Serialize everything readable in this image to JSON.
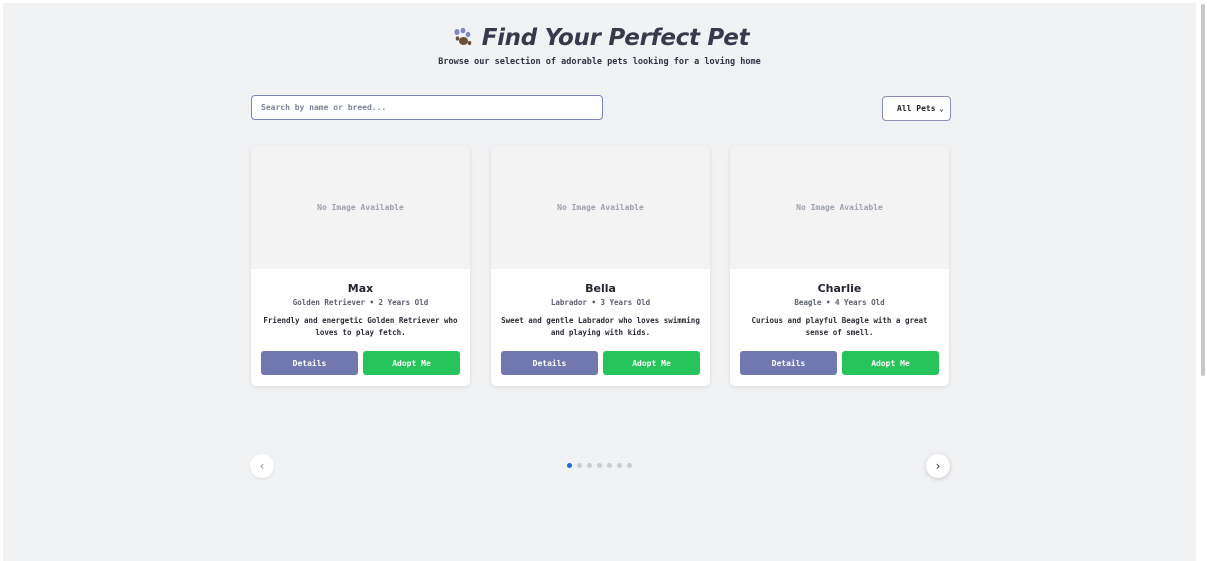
{
  "header": {
    "title": "Find Your Perfect Pet",
    "subtitle": "Browse our selection of adorable pets looking for a loving home",
    "icon": "paw-icon"
  },
  "search": {
    "placeholder": "Search by name or breed...",
    "value": ""
  },
  "filter": {
    "selected": "All Pets"
  },
  "cards": [
    {
      "image_text": "No Image Available",
      "name": "Max",
      "meta": "Golden Retriever • 2 Years Old",
      "description": "Friendly and energetic Golden Retriever who loves to play fetch.",
      "details_label": "Details",
      "adopt_label": "Adopt Me"
    },
    {
      "image_text": "No Image Available",
      "name": "Bella",
      "meta": "Labrador • 3 Years Old",
      "description": "Sweet and gentle Labrador who loves swimming and playing with kids.",
      "details_label": "Details",
      "adopt_label": "Adopt Me"
    },
    {
      "image_text": "No Image Available",
      "name": "Charlie",
      "meta": "Beagle • 4 Years Old",
      "description": "Curious and playful Beagle with a great sense of smell.",
      "details_label": "Details",
      "adopt_label": "Adopt Me"
    }
  ],
  "carousel": {
    "prev_icon": "chevron-left-icon",
    "next_icon": "chevron-right-icon",
    "active_page": 1,
    "page_count": 7
  },
  "colors": {
    "accent": "#7178b0",
    "adopt": "#26c45a",
    "active_dot": "#1e6fd9"
  }
}
